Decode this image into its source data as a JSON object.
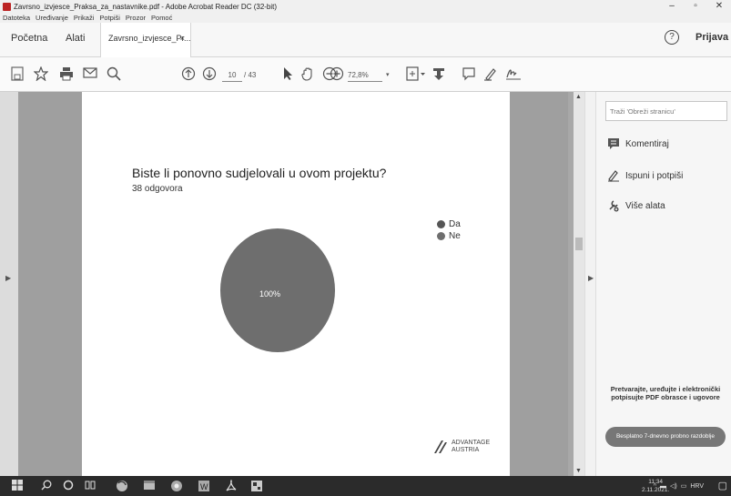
{
  "window": {
    "title": "Zavrsno_izvjesce_Praksa_za_nastavnike.pdf - Adobe Acrobat Reader DC (32-bit)",
    "controls": [
      "–",
      "▫",
      "✕"
    ]
  },
  "menu": [
    "Datoteka",
    "Uređivanje",
    "Prikaži",
    "Potpiši",
    "Prozor",
    "Pomoć"
  ],
  "tabs": {
    "home": "Početna",
    "tools": "Alati",
    "document": "Zavrsno_izvjesce_Pr...",
    "close": "×"
  },
  "header": {
    "signin": "Prijava",
    "help": "?"
  },
  "toolbar": {
    "page_current": "10",
    "page_total": "/ 43",
    "zoom": "72,8%",
    "zoom_caret": "▾"
  },
  "document": {
    "question": "Biste li ponovno sudjelovali u ovom projektu?",
    "response_count": "38 odgovora",
    "logo_text_1": "ADVANTAGE",
    "logo_text_2": "AUSTRIA"
  },
  "chart_data": {
    "type": "pie",
    "title": "Biste li ponovno sudjelovali u ovom projektu?",
    "subtitle": "38 odgovora",
    "categories": [
      "Da",
      "Ne"
    ],
    "values": [
      0,
      100
    ],
    "slice_labels": [
      "",
      "100%"
    ],
    "colors": [
      "#555555",
      "#6e6e6e"
    ],
    "legend_placement": "right"
  },
  "right_pane": {
    "search_placeholder": "Traži 'Obreži stranicu'",
    "tools": [
      {
        "label": "Komentiraj",
        "icon": "comment-icon"
      },
      {
        "label": "Ispuni i potpiši",
        "icon": "sign-pen-icon"
      },
      {
        "label": "Više alata",
        "icon": "more-tools-icon"
      }
    ],
    "promo": "Pretvarajte, uređujte i elektronički potpisujte PDF obrasce i ugovore",
    "trial_button": "Besplatno 7-dnevno probno razdoblje"
  },
  "taskbar": {
    "language": "HRV",
    "time": "11:34",
    "date": "2.11.2021."
  }
}
